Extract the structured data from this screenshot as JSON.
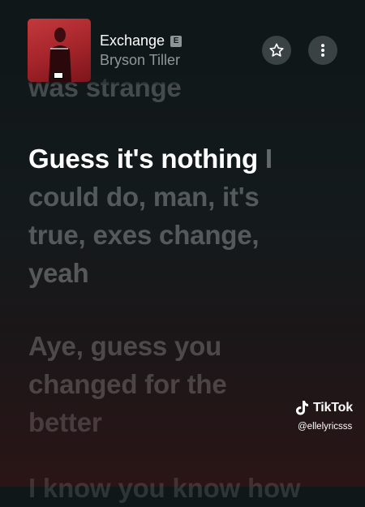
{
  "track": {
    "title": "Exchange",
    "explicit_badge": "E",
    "artist": "Bryson Tiller"
  },
  "lyrics": {
    "previous_line": "was strange",
    "current_sung": "Guess it's nothing",
    "current_rest": " I",
    "following": [
      "could do, man, it's",
      "true, exes change,",
      "yeah"
    ],
    "next_block": [
      "Aye, guess you",
      "changed for the",
      "better"
    ],
    "partial_next": "I know you know how"
  },
  "controls": {
    "favorite_icon": "star-icon",
    "more_icon": "more-vertical-icon"
  },
  "watermark": {
    "brand": "TikTok",
    "handle": "@ellelyricsss"
  },
  "colors": {
    "background_top": "#0f1719",
    "background_bottom": "#2a1516",
    "album_art": "#b32b30",
    "button_bg": "#3a4244"
  }
}
